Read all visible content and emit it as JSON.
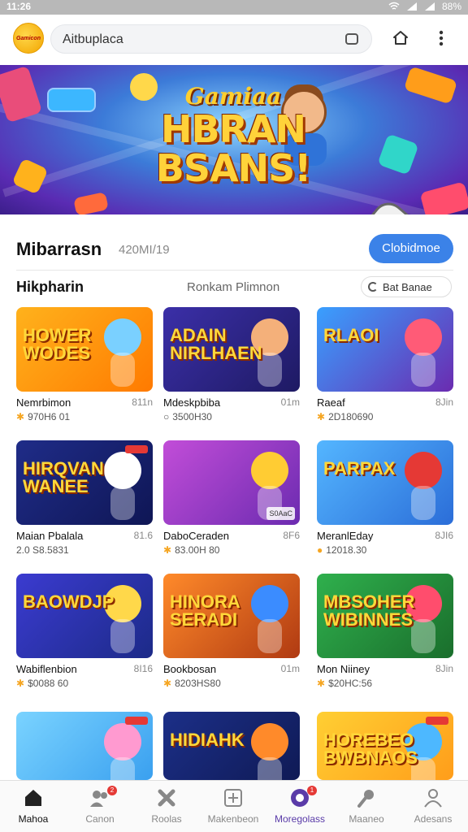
{
  "status": {
    "time": "11:26",
    "battery": "88%"
  },
  "topbar": {
    "logo_text": "Gamicon",
    "search_placeholder": "Aitbuplaca"
  },
  "banner": {
    "kicker": "Gamiaa",
    "line1": "HBRAN",
    "line2": "BSANS!"
  },
  "section": {
    "title": "Mibarrasn",
    "count": "420MI/19",
    "cta": "Clobidmoe"
  },
  "subheader": {
    "left": "Hikpharin",
    "middle": "Ronkam Plimnon",
    "filter": "Bat Banae"
  },
  "games": [
    {
      "title": "HOWER WODES",
      "name": "Nemrbimon",
      "size": "811n",
      "meta": "970H6 01",
      "meta_icon": "star",
      "bg": [
        "#ffb21c",
        "#ff7a00"
      ],
      "blob": "#7ad0ff",
      "badge": "",
      "tag": false
    },
    {
      "title": "ADAIN NIRLHAEN",
      "name": "Mdeskpbiba",
      "size": "01m",
      "meta": "3500H30",
      "meta_icon": "search",
      "bg": [
        "#3b2fa8",
        "#1e1a63"
      ],
      "blob": "#f4b07a",
      "badge": "",
      "tag": false
    },
    {
      "title": "RLAOI",
      "name": "Raeaf",
      "size": "8Jin",
      "meta": "2D180690",
      "meta_icon": "star",
      "bg": [
        "#39a0ff",
        "#6b2bb0"
      ],
      "blob": "#ff5b77",
      "badge": "",
      "tag": false
    },
    {
      "title": "HIRQVAN WANEE",
      "name": "Maian Pbalala",
      "size": "81.6",
      "meta": "2.0 S8.5831",
      "meta_icon": "none",
      "bg": [
        "#1f2c88",
        "#0f1655"
      ],
      "blob": "#ffffff",
      "badge": "",
      "tag": true
    },
    {
      "title": "",
      "name": "DaboCeraden",
      "size": "8F6",
      "meta": "83.00H 80",
      "meta_icon": "star",
      "bg": [
        "#c24dd8",
        "#6b2bb0"
      ],
      "blob": "#ffcc33",
      "badge": "S0AaC",
      "tag": false
    },
    {
      "title": "PARPAX",
      "name": "MeranlEday",
      "size": "8JI6",
      "meta": "12018.30",
      "meta_icon": "circle",
      "bg": [
        "#54b6ff",
        "#2b6dd8"
      ],
      "blob": "#e53935",
      "badge": "",
      "tag": false
    },
    {
      "title": "BAOWDJP",
      "name": "Wabiflenbion",
      "size": "8I16",
      "meta": "$0088 60",
      "meta_icon": "star",
      "bg": [
        "#3b3bd0",
        "#1c2a88"
      ],
      "blob": "#ffd84a",
      "badge": "",
      "tag": false
    },
    {
      "title": "HINORA SERADI",
      "name": "Bookbosan",
      "size": "01m",
      "meta": "8203HS80",
      "meta_icon": "star",
      "bg": [
        "#ff8a2a",
        "#b03a12"
      ],
      "blob": "#3b8cff",
      "badge": "",
      "tag": false
    },
    {
      "title": "MBSOHER WIBINNES",
      "name": "Mon Niiney",
      "size": "8Jin",
      "meta": "$20HC:56",
      "meta_icon": "star",
      "bg": [
        "#2fb04d",
        "#1a6e2c"
      ],
      "blob": "#ff4d6d",
      "badge": "",
      "tag": false
    },
    {
      "title": "",
      "name": "",
      "size": "",
      "meta": "",
      "meta_icon": "none",
      "bg": [
        "#7ad3ff",
        "#3aa0ef"
      ],
      "blob": "#ff9ad0",
      "badge": "",
      "tag": true
    },
    {
      "title": "HIDIAHK",
      "name": "",
      "size": "",
      "meta": "",
      "meta_icon": "none",
      "bg": [
        "#1c2f88",
        "#0f1a55"
      ],
      "blob": "#ff8a2a",
      "badge": "",
      "tag": false
    },
    {
      "title": "HOREBEO BWBNAOS",
      "name": "",
      "size": "",
      "meta": "",
      "meta_icon": "none",
      "bg": [
        "#ffcf33",
        "#ff9d1a"
      ],
      "blob": "#4db8ff",
      "badge": "",
      "tag": true
    }
  ],
  "nav": [
    {
      "label": "Mahoa",
      "icon": "home-icon",
      "state": "active",
      "badge": ""
    },
    {
      "label": "Canon",
      "icon": "people-icon",
      "state": "",
      "badge": "2"
    },
    {
      "label": "Roolas",
      "icon": "puzzle-icon",
      "state": "",
      "badge": ""
    },
    {
      "label": "Makenbeon",
      "icon": "plus-box-icon",
      "state": "",
      "badge": ""
    },
    {
      "label": "Moregolass",
      "icon": "game-circle-icon",
      "state": "highlight",
      "badge": "1"
    },
    {
      "label": "Maaneo",
      "icon": "pen-icon",
      "state": "",
      "badge": ""
    },
    {
      "label": "Adesans",
      "icon": "profile-icon",
      "state": "",
      "badge": ""
    }
  ]
}
